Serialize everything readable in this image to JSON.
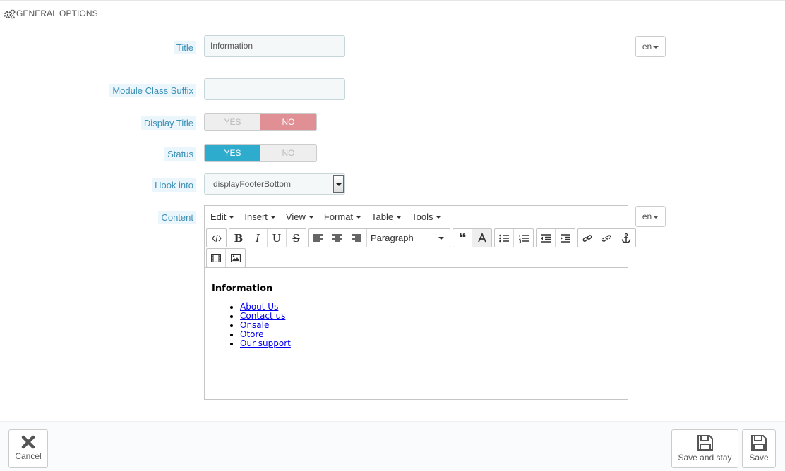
{
  "panel": {
    "title": "GENERAL OPTIONS",
    "icon": "gears-icon"
  },
  "form": {
    "title": {
      "label": "Title",
      "value": "Information",
      "lang": "en"
    },
    "suffix": {
      "label": "Module Class Suffix",
      "value": ""
    },
    "display_title": {
      "label": "Display Title",
      "yes": "YES",
      "no": "NO",
      "selected": "NO"
    },
    "status": {
      "label": "Status",
      "yes": "YES",
      "no": "NO",
      "selected": "YES"
    },
    "hook": {
      "label": "Hook into",
      "value": "displayFooterBottom"
    },
    "content": {
      "label": "Content",
      "lang": "en",
      "menu": [
        "Edit",
        "Insert",
        "View",
        "Format",
        "Table",
        "Tools"
      ],
      "format_select": "Paragraph",
      "heading": "Information",
      "links": [
        "About Us",
        "Contact us",
        "Onsale",
        "Otore",
        "Our support"
      ]
    }
  },
  "footer": {
    "cancel": "Cancel",
    "save_stay": "Save and stay",
    "save": "Save"
  },
  "colors": {
    "accent": "#2eacce",
    "no_active": "#e08f95",
    "label_text": "#3d8fb5"
  }
}
